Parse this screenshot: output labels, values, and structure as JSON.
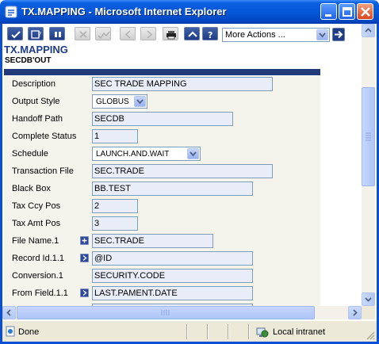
{
  "window": {
    "title": "TX.MAPPING - Microsoft Internet Explorer",
    "title_color": "#0558d8"
  },
  "toolbar": {
    "buttons": [
      {
        "name": "commit-button",
        "icon": "checkmark-icon",
        "enabled": true
      },
      {
        "name": "validate-button",
        "icon": "hold-icon",
        "enabled": true
      },
      {
        "name": "hold-button",
        "icon": "pause-icon",
        "enabled": true
      },
      {
        "name": "delete-button",
        "icon": "delete-icon",
        "enabled": false
      },
      {
        "name": "authorise-button",
        "icon": "authorise-icon",
        "enabled": false
      },
      {
        "name": "previous-button",
        "icon": "chevron-left-icon",
        "enabled": false
      },
      {
        "name": "next-button",
        "icon": "chevron-right-icon",
        "enabled": false
      },
      {
        "name": "print-button",
        "icon": "printer-icon",
        "enabled": true
      },
      {
        "name": "help-up-button",
        "icon": "chevron-up-icon",
        "enabled": true
      },
      {
        "name": "help-button",
        "icon": "question-icon",
        "enabled": true
      }
    ],
    "more_actions": "More Actions ..."
  },
  "page": {
    "title": "TX.MAPPING",
    "record_id": "SECDB'OUT",
    "accent": "#233a7a",
    "title_color": "#1e3c8c"
  },
  "fields": [
    {
      "label": "Description",
      "value": "SEC TRADE MAPPING"
    },
    {
      "label": "Output Style",
      "value": "GLOBUS"
    },
    {
      "label": "Handoff Path",
      "value": "SECDB"
    },
    {
      "label": "Complete Status",
      "value": "1"
    },
    {
      "label": "Schedule",
      "value": "LAUNCH.AND.WAIT"
    },
    {
      "label": "Transaction File",
      "value": "SEC.TRADE"
    },
    {
      "label": "Black Box",
      "value": "BB.TEST"
    },
    {
      "label": "Tax Ccy Pos",
      "value": "2"
    },
    {
      "label": "Tax Amt Pos",
      "value": "3"
    },
    {
      "label": "File Name.1",
      "value": "SEC.TRADE"
    },
    {
      "label": "Record Id.1.1",
      "value": "@ID"
    },
    {
      "label": "Conversion.1",
      "value": "SECURITY.CODE"
    },
    {
      "label": "From Field.1.1",
      "value": "LAST.PAMENT.DATE"
    }
  ],
  "statusbar": {
    "status": "Done",
    "zone": "Local intranet"
  }
}
